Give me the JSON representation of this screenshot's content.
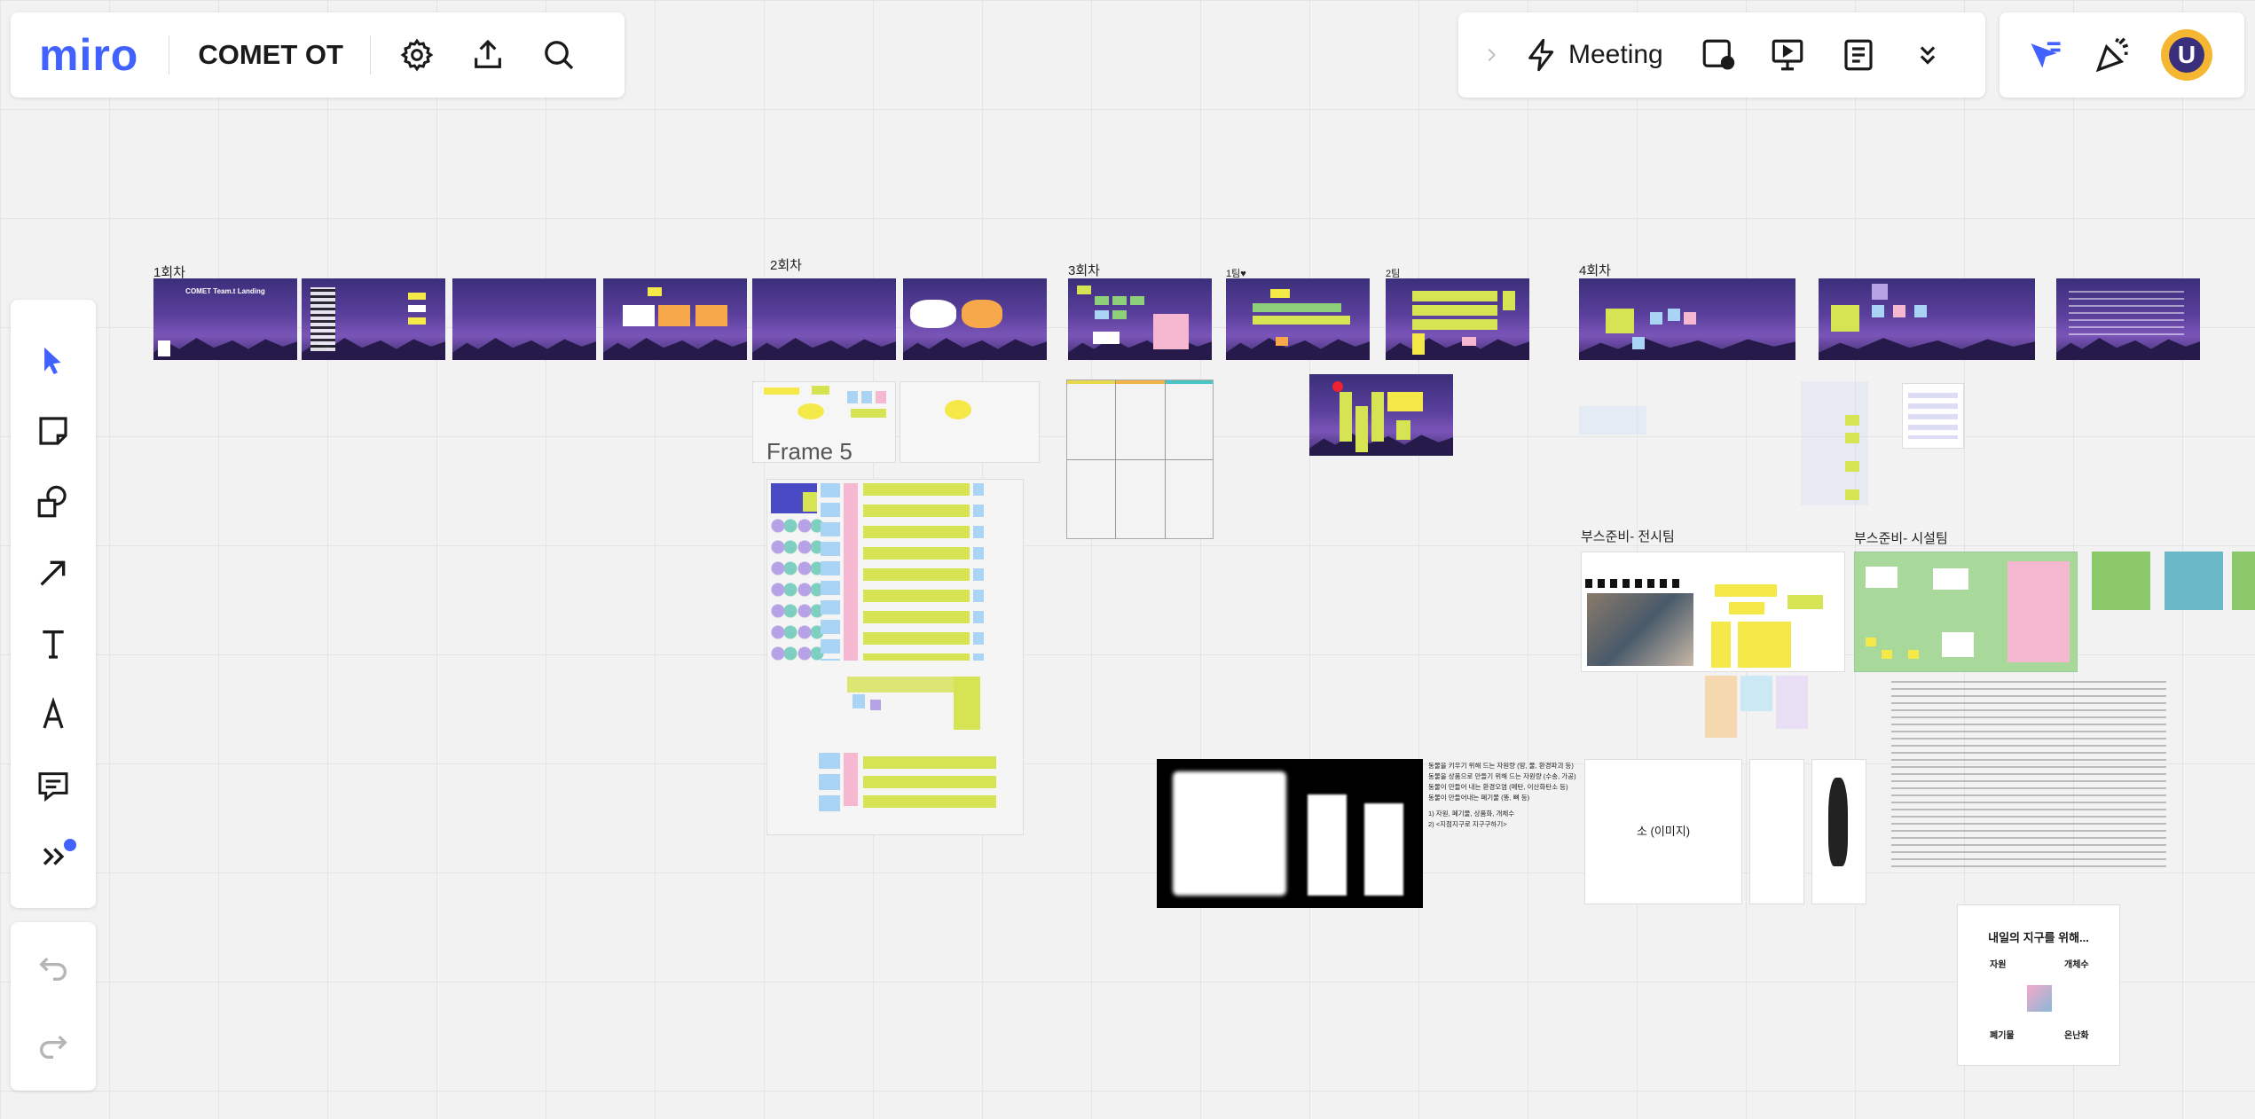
{
  "board": {
    "logo": "miro",
    "title": "COMET OT"
  },
  "topbar": {
    "meeting_label": "Meeting"
  },
  "frames": {
    "session1": "1회차",
    "session2": "2회차",
    "session3": "3회차",
    "team1": "1팀♥",
    "team2": "2팀",
    "session4": "4회차",
    "frame5": "Frame 5",
    "booth_display": "부스준비- 전시팀",
    "booth_facility": "부스준비- 시설팀"
  },
  "slides": {
    "landing_title": "COMET Team.t Landing"
  },
  "canvas_text": {
    "cow_image": "소 (이미지)",
    "tomorrow_earth": "내일의 지구를 위해...",
    "resources": "자원",
    "individuals": "개체수",
    "waste": "폐기물",
    "warming": "온난화",
    "note_line1": "동물을 키우기 위해 드는 자원량 (땅, 물, 환경파괴 등)",
    "note_line2": "동물을 상품으로 만들기 위해 드는 자원량 (수송, 가공)",
    "note_line3": "동물이 만들어 내는 환경오염 (메탄, 이산화탄소 등)",
    "note_line4": "동물이 만들어내는 폐기물 (똥, 뼈 등)",
    "note_line5": "1) 자원, 폐기물, 상품화, 개체수",
    "note_line6": "2) <지점지구로 지구구하기>"
  },
  "colors": {
    "accent": "#4262ff",
    "sticky_yellow": "#d6e352",
    "sticky_pink": "#f6b8d0",
    "sticky_blue": "#a9d4f5"
  }
}
